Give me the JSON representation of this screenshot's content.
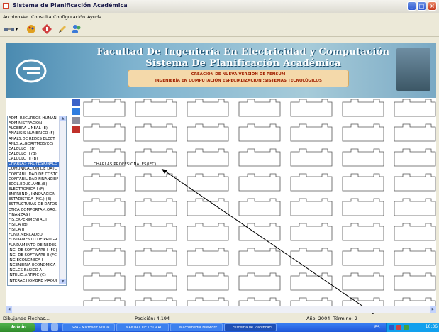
{
  "window": {
    "title": "Sistema de Planificación Académica"
  },
  "menu": [
    "Archivo",
    "Ver",
    "Consulta",
    "Configuración",
    "Ayuda"
  ],
  "banner": {
    "line1": "Facultad De Ingeniería En Electricidad y Computación",
    "line2": "Sistema De Planificación Académica",
    "sub1": "CREACIÓN DE NUEVA VERSIÓN DE PÉNSUM",
    "sub2": "INGENIERÍA EN COMPUTACIÓN ESPECIALIZACION :SISTEMAS TECNOLÓGICOS"
  },
  "subjects": [
    "ADM. RECURSOS HUMAN",
    "ADMINISTRACION",
    "ALGEBRA LINEAL (E)",
    "ANALISIS NUMERICO (F)",
    "ANALS.DE REDES ELECT",
    "ANLS.ALGORITMOS(EC)",
    "CALCULO I (B)",
    "CALCULO II (B)",
    "CALCULO III (B)",
    "CHARLAS PROFESIONALE",
    "COMUNICACION DE DATC",
    "CONTABILIDAD DE COSTC",
    "CONTABILIDAD FINANCIEF",
    "ECOL.EDUC.AMB.(E)",
    "ELECTRONICA I (F)",
    "EMPREND., INNOVACION",
    "ESTADISTICA (NG.) (B)",
    "ESTRUCTURAS DE DATOS",
    "ETICA COMPORTAM.ORG.",
    "FINANZAS I",
    "FIS.EXPERIMENTAL I",
    "FISICA (B)",
    "FISICA II",
    "FUND.MERCADEO",
    "FUNDAMENTO DE PROGR",
    "FUNDAMENTO DE REDES",
    "ING. DE SOFTWARE I (FC)",
    "ING. DE SOFTWARE II (FC",
    "ING.ECONOMICA I",
    "INGENIERIA ECONOMICA",
    "INGLCS BáSICO A",
    "INTELIG.ARTIFIC (C)",
    "INTERAC.HOMBRE MAQUI"
  ],
  "selected_subject_index": 9,
  "placed_box_label": "CHARLAS PROFESIONALES(IEC)",
  "status": {
    "mode": "Dibujando Flechas...",
    "position": "Posición: 4,194",
    "year": "Año: 2004",
    "term": "Término: 2"
  },
  "taskbar": {
    "start": "Inicio",
    "tasks": [
      "SPA - Microsoft Visual ...",
      "MANUAL DE USUARI...",
      "Macromedia Firework...",
      "Sistema de Planificaci..."
    ],
    "lang": "ES",
    "clock": "16:36"
  },
  "colors": {
    "accent": "#316ac5",
    "banner": "#6aa3c4",
    "subtitle_red": "#a02000",
    "scroll_bg": "#f4d9aa"
  }
}
